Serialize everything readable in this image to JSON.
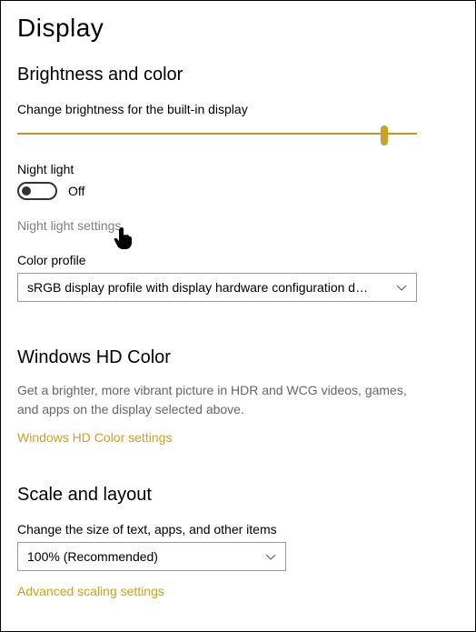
{
  "page": {
    "title": "Display"
  },
  "brightness": {
    "section_title": "Brightness and color",
    "slider_label": "Change brightness for the built-in display",
    "slider_pct": 93,
    "night_light_label": "Night light",
    "night_light_status": "Off",
    "night_light_settings": "Night light settings",
    "color_profile_label": "Color profile",
    "color_profile_value": "sRGB display profile with display hardware configuration d…"
  },
  "hdcolor": {
    "section_title": "Windows HD Color",
    "desc": "Get a brighter, more vibrant picture in HDR and WCG videos, games, and apps on the display selected above.",
    "link": "Windows HD Color settings"
  },
  "scale": {
    "section_title": "Scale and layout",
    "size_label": "Change the size of text, apps, and other items",
    "size_value": "100% (Recommended)",
    "advanced_link": "Advanced scaling settings"
  },
  "colors": {
    "accent": "#c9a227"
  }
}
